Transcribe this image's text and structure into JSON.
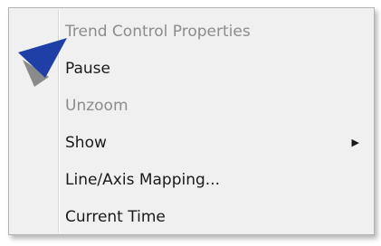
{
  "context_menu": {
    "items": [
      {
        "label": "Trend Control Properties",
        "enabled": false,
        "submenu": false
      },
      {
        "label": "Pause",
        "enabled": true,
        "submenu": false,
        "icon": "pause-triangle-icon"
      },
      {
        "label": "Unzoom",
        "enabled": false,
        "submenu": false
      },
      {
        "label": "Show",
        "enabled": true,
        "submenu": true,
        "submenu_glyph": "▶"
      },
      {
        "label": "Line/Axis Mapping...",
        "enabled": true,
        "submenu": false
      },
      {
        "label": "Current Time",
        "enabled": true,
        "submenu": false
      }
    ],
    "colors": {
      "background": "#f0f0f0",
      "text": "#1a1a1a",
      "disabled_text": "#8c8c8c",
      "icon_primary": "#1f3fa6",
      "icon_shadow": "#8a8a8a"
    }
  }
}
